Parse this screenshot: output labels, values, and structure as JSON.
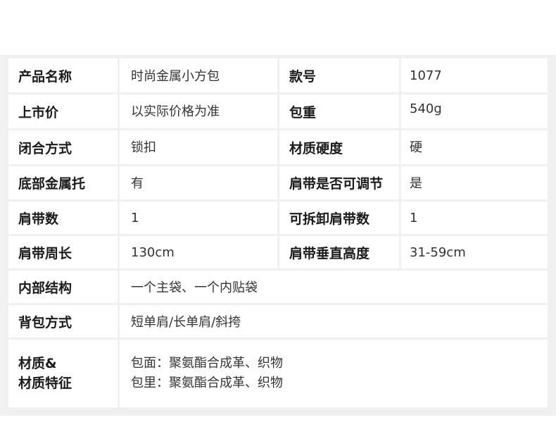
{
  "spec_table": {
    "rows": [
      {
        "label1": "产品名称",
        "value1": "时尚金属小方包",
        "label2": "款号",
        "value2": "1077"
      },
      {
        "label1": "上市价",
        "value1": "以实际价格为准",
        "label2": "包重",
        "value2": "540g"
      },
      {
        "label1": "闭合方式",
        "value1": "锁扣",
        "label2": "材质硬度",
        "value2": "硬"
      },
      {
        "label1": "底部金属托",
        "value1": "有",
        "label2": "肩带是否可调节",
        "value2": "是"
      },
      {
        "label1": "肩带数",
        "value1": "1",
        "label2": "可拆卸肩带数",
        "value2": "1"
      },
      {
        "label1": "肩带周长",
        "value1": "130cm",
        "label2": "肩带垂直高度",
        "value2": "31-59cm"
      }
    ],
    "internal_structure": {
      "label": "内部结构",
      "value": "一个主袋、一个内贴袋"
    },
    "carry_method": {
      "label": "背包方式",
      "value": "短单肩/长单肩/斜挎"
    },
    "material": {
      "label_line1": "材质&",
      "label_line2": "材质特征",
      "value_line1": "包面：聚氨酯合成革、织物",
      "value_line2": "包里：聚氨酯合成革、织物"
    }
  }
}
